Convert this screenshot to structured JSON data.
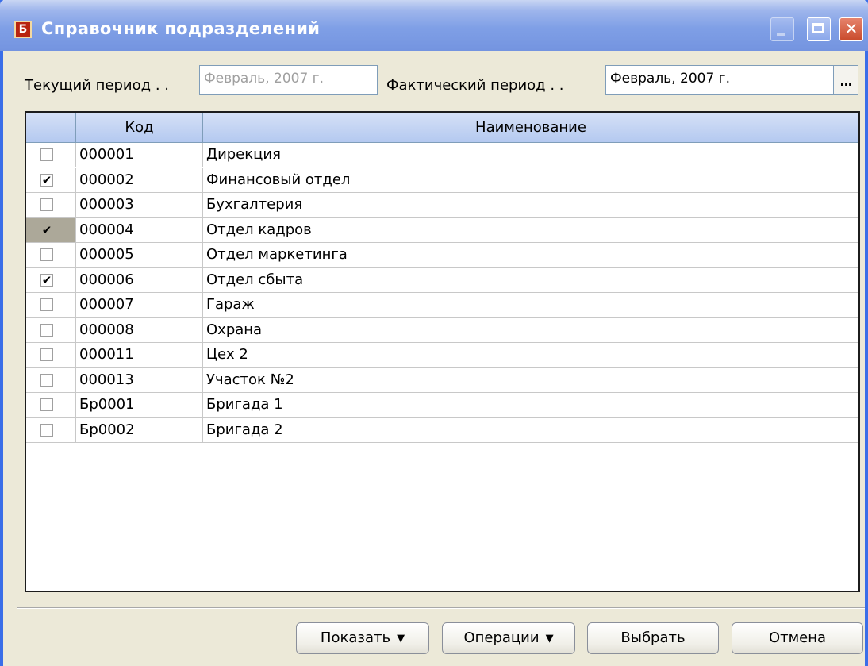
{
  "window": {
    "title": "Справочник подразделений",
    "icon_letter": "Б"
  },
  "period": {
    "current_label": "Текущий период . .",
    "current_value": "Февраль, 2007 г.",
    "actual_label": "Фактический период . .",
    "actual_value": "Февраль, 2007 г.",
    "select_button": "..."
  },
  "grid": {
    "columns": [
      "Код",
      "Наименование"
    ],
    "rows": [
      {
        "checked": false,
        "code": "000001",
        "name": "Дирекция"
      },
      {
        "checked": true,
        "code": "000002",
        "name": "Финансовый отдел"
      },
      {
        "checked": false,
        "code": "000003",
        "name": "Бухгалтерия"
      },
      {
        "checked": true,
        "code": "000004",
        "name": "Отдел кадров",
        "current": true
      },
      {
        "checked": false,
        "code": "000005",
        "name": "Отдел маркетинга"
      },
      {
        "checked": true,
        "code": "000006",
        "name": "Отдел сбыта"
      },
      {
        "checked": false,
        "code": "000007",
        "name": "Гараж"
      },
      {
        "checked": false,
        "code": "000008",
        "name": "Охрана"
      },
      {
        "checked": false,
        "code": "000011",
        "name": "Цех 2"
      },
      {
        "checked": false,
        "code": "000013",
        "name": "Участок №2"
      },
      {
        "checked": false,
        "code": "Бр0001",
        "name": "Бригада 1"
      },
      {
        "checked": false,
        "code": "Бр0002",
        "name": "Бригада 2"
      }
    ]
  },
  "buttons": {
    "show": "Показать",
    "operations": "Операции",
    "select": "Выбрать",
    "cancel": "Отмена",
    "dropdown_arrow": "▼"
  },
  "colors": {
    "titlebar": "#7f9fe6",
    "window_bg": "#ece9d8",
    "header_bg": "#b4c9f0",
    "current_row_marker": "#aca899"
  }
}
